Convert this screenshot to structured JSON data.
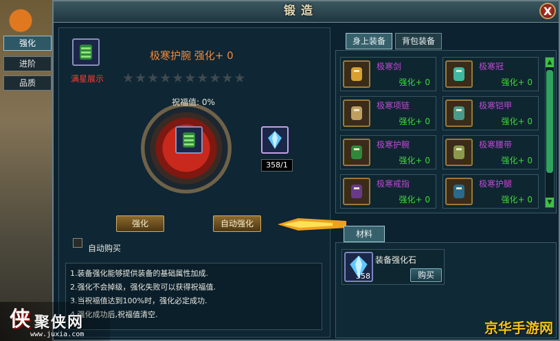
{
  "window": {
    "title": "锻造",
    "close_label": "X"
  },
  "side_tabs": [
    {
      "label": "强化",
      "active": true
    },
    {
      "label": "进阶",
      "active": false
    },
    {
      "label": "品质",
      "active": false
    }
  ],
  "forge": {
    "preview_label": "满星展示",
    "equip_title": "极寒护腕  强化+ 0",
    "stars_total": 10,
    "stars_filled": 0,
    "blessing_text": "祝福值: 0%",
    "material_count": "358/1",
    "buttons": {
      "strengthen": "强化",
      "auto_strengthen": "自动强化"
    },
    "auto_buy_label": "自动购买",
    "auto_buy_checked": false,
    "rules": [
      "1.装备强化能够提供装备的基础属性加成.",
      "2.强化不会掉级，强化失败可以获得祝福值.",
      "3.当祝福值达到100%时，强化必定成功.",
      "4.强化成功后,祝福值清空."
    ]
  },
  "equip_tabs": [
    {
      "label": "身上装备",
      "active": true
    },
    {
      "label": "背包装备",
      "active": false
    }
  ],
  "equipment": [
    {
      "name": "极寒剑",
      "level": "强化+ 0",
      "icon": "sword-icon"
    },
    {
      "name": "极寒冠",
      "level": "强化+ 0",
      "icon": "crown-icon"
    },
    {
      "name": "极寒项链",
      "level": "强化+ 0",
      "icon": "necklace-icon"
    },
    {
      "name": "极寒铠甲",
      "level": "强化+ 0",
      "icon": "armor-icon"
    },
    {
      "name": "极寒护腕",
      "level": "强化+ 0",
      "icon": "bracer-icon"
    },
    {
      "name": "极寒腰带",
      "level": "强化+ 0",
      "icon": "belt-icon"
    },
    {
      "name": "极寒戒指",
      "level": "强化+ 0",
      "icon": "ring-icon"
    },
    {
      "name": "极寒护腿",
      "level": "强化+ 0",
      "icon": "leggings-icon"
    }
  ],
  "materials": {
    "tab_label": "材料",
    "item_name": "装备强化石",
    "item_count": "358",
    "buy_label": "购买"
  },
  "watermarks": {
    "left_logo_big": "侠",
    "left_logo_side": "聚侠网",
    "left_url": "www.juxia.com",
    "right_logo": "京华手游网"
  },
  "colors": {
    "equip_name": "#c04ad6",
    "equip_level": "#3fd83a",
    "title_orange": "#f08a3a",
    "preview_red": "#ff3b2f"
  }
}
